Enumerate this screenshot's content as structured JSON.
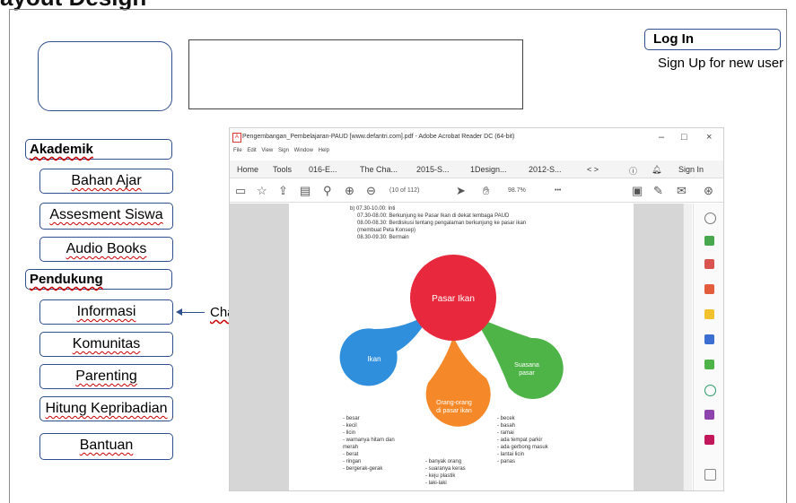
{
  "page_title": "ayout Design",
  "auth": {
    "login_label": "Log In",
    "signup_label": "Sign Up for new user"
  },
  "sections": {
    "akademik": "Akademik",
    "pendukung": "Pendukung"
  },
  "akademik_items": [
    "Bahan Ajar",
    "Assesment Siswa",
    "Audio Books"
  ],
  "pendukung_items": [
    "Informasi",
    "Komunitas",
    "Parenting",
    "Hitung Kepribadian",
    "Bantuan"
  ],
  "annotation": {
    "chatbot": "ChatBot"
  },
  "pdf": {
    "window_title": "Pengembangan_Pembelajaran-PAUD [www.defantri.com].pdf - Adobe Acrobat Reader DC (64-bit)",
    "menu": [
      "File",
      "Edit",
      "View",
      "Sign",
      "Window",
      "Help"
    ],
    "tabs": [
      "Home",
      "Tools",
      "016-E...",
      "The Cha...",
      "2015-S...",
      "1Design...",
      "2012-S..."
    ],
    "signin": "Sign In",
    "page_indicator": "(10 of 112)",
    "zoom": "98.7%",
    "doc_lines": [
      "b)  07.30-10.00: Inti",
      "07.30-08.00: Berkunjung ke Pasar Ikan di dekat lembaga PAUD",
      "08.00-08.30: Berdiskusi tentang pengalaman berkunjung ke pasar ikan",
      "(membuat Peta Konsep)",
      "08.30-09.30: Bermain"
    ],
    "concept_map": {
      "center": "Pasar Ikan",
      "left": "Ikan",
      "bottom": [
        "Orang-orang",
        "di pasar ikan"
      ],
      "right": [
        "Suasana",
        "pasar"
      ],
      "colors": {
        "center": "#e8283c",
        "left": "#2f8fdc",
        "bottom": "#f5892a",
        "right": "#4eb448"
      },
      "left_list": [
        "- besar",
        "- kecil",
        "- licin",
        "- warnanya hitam dan",
        "  merah",
        "- berat",
        "- ringan",
        "- bergerak-gerak"
      ],
      "bottom_list": [
        "- banyak orang",
        "- suaranya keras",
        "- keju plastik",
        "- laki-laki"
      ],
      "right_list": [
        "- becek",
        "- basah",
        "- ramai",
        "- ada tempat parkir",
        "- ada gerbong masuk",
        "- lantai licin",
        "- panas"
      ]
    }
  }
}
